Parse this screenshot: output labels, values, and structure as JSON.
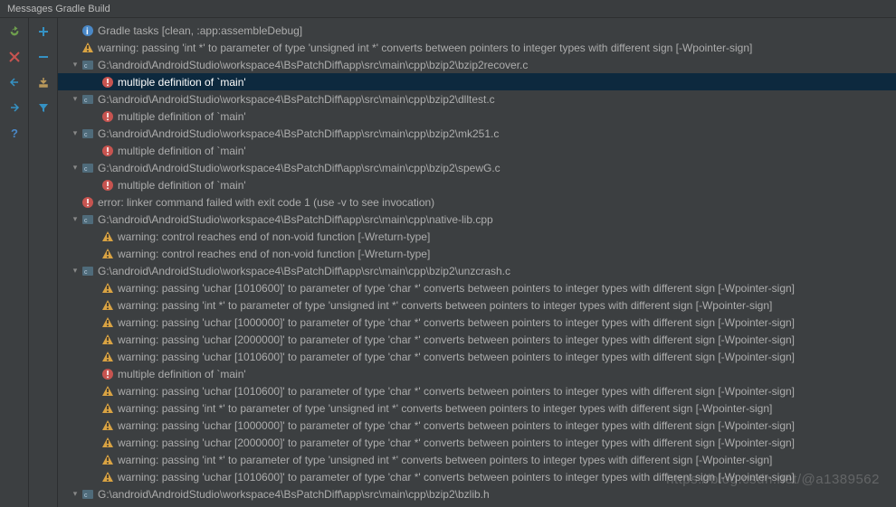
{
  "header": {
    "title": "Messages Gradle Build"
  },
  "toolbar1": {
    "refresh": "refresh",
    "stop": "stop",
    "up": "up",
    "down": "down",
    "help": "help"
  },
  "toolbar2": {
    "expand": "expand",
    "collapse": "collapse",
    "export": "export",
    "filter": "filter"
  },
  "watermark": "https://blog.csdn.net/@a1389562",
  "tree": [
    {
      "indent": 0,
      "arrow": false,
      "icon": "info",
      "text": "Gradle tasks [clean, :app:assembleDebug]"
    },
    {
      "indent": 0,
      "arrow": false,
      "icon": "warn",
      "text": "warning: passing 'int *' to parameter of type 'unsigned int *' converts between pointers to integer types with different sign [-Wpointer-sign]"
    },
    {
      "indent": 0,
      "arrow": true,
      "icon": "cpp",
      "text": "G:\\android\\AndroidStudio\\workspace4\\BsPatchDiff\\app\\src\\main\\cpp\\bzip2\\bzip2recover.c"
    },
    {
      "indent": 1,
      "arrow": false,
      "icon": "error",
      "text": "multiple definition of `main'",
      "selected": true
    },
    {
      "indent": 0,
      "arrow": true,
      "icon": "cpp",
      "text": "G:\\android\\AndroidStudio\\workspace4\\BsPatchDiff\\app\\src\\main\\cpp\\bzip2\\dlltest.c"
    },
    {
      "indent": 1,
      "arrow": false,
      "icon": "error",
      "text": "multiple definition of `main'"
    },
    {
      "indent": 0,
      "arrow": true,
      "icon": "cpp",
      "text": "G:\\android\\AndroidStudio\\workspace4\\BsPatchDiff\\app\\src\\main\\cpp\\bzip2\\mk251.c"
    },
    {
      "indent": 1,
      "arrow": false,
      "icon": "error",
      "text": "multiple definition of `main'"
    },
    {
      "indent": 0,
      "arrow": true,
      "icon": "cpp",
      "text": "G:\\android\\AndroidStudio\\workspace4\\BsPatchDiff\\app\\src\\main\\cpp\\bzip2\\spewG.c"
    },
    {
      "indent": 1,
      "arrow": false,
      "icon": "error",
      "text": "multiple definition of `main'"
    },
    {
      "indent": 0,
      "arrow": false,
      "icon": "error",
      "text": "error: linker command failed with exit code 1 (use -v to see invocation)"
    },
    {
      "indent": 0,
      "arrow": true,
      "icon": "cpp",
      "text": "G:\\android\\AndroidStudio\\workspace4\\BsPatchDiff\\app\\src\\main\\cpp\\native-lib.cpp"
    },
    {
      "indent": 1,
      "arrow": false,
      "icon": "warn",
      "text": "warning: control reaches end of non-void function [-Wreturn-type]"
    },
    {
      "indent": 1,
      "arrow": false,
      "icon": "warn",
      "text": "warning: control reaches end of non-void function [-Wreturn-type]"
    },
    {
      "indent": 0,
      "arrow": true,
      "icon": "cpp",
      "text": "G:\\android\\AndroidStudio\\workspace4\\BsPatchDiff\\app\\src\\main\\cpp\\bzip2\\unzcrash.c"
    },
    {
      "indent": 1,
      "arrow": false,
      "icon": "warn",
      "text": "warning: passing 'uchar [1010600]' to parameter of type 'char *' converts between pointers to integer types with different sign [-Wpointer-sign]"
    },
    {
      "indent": 1,
      "arrow": false,
      "icon": "warn",
      "text": "warning: passing 'int *' to parameter of type 'unsigned int *' converts between pointers to integer types with different sign [-Wpointer-sign]"
    },
    {
      "indent": 1,
      "arrow": false,
      "icon": "warn",
      "text": "warning: passing 'uchar [1000000]' to parameter of type 'char *' converts between pointers to integer types with different sign [-Wpointer-sign]"
    },
    {
      "indent": 1,
      "arrow": false,
      "icon": "warn",
      "text": "warning: passing 'uchar [2000000]' to parameter of type 'char *' converts between pointers to integer types with different sign [-Wpointer-sign]"
    },
    {
      "indent": 1,
      "arrow": false,
      "icon": "warn",
      "text": "warning: passing 'uchar [1010600]' to parameter of type 'char *' converts between pointers to integer types with different sign [-Wpointer-sign]"
    },
    {
      "indent": 1,
      "arrow": false,
      "icon": "error",
      "text": "multiple definition of `main'"
    },
    {
      "indent": 1,
      "arrow": false,
      "icon": "warn",
      "text": "warning: passing 'uchar [1010600]' to parameter of type 'char *' converts between pointers to integer types with different sign [-Wpointer-sign]"
    },
    {
      "indent": 1,
      "arrow": false,
      "icon": "warn",
      "text": "warning: passing 'int *' to parameter of type 'unsigned int *' converts between pointers to integer types with different sign [-Wpointer-sign]"
    },
    {
      "indent": 1,
      "arrow": false,
      "icon": "warn",
      "text": "warning: passing 'uchar [1000000]' to parameter of type 'char *' converts between pointers to integer types with different sign [-Wpointer-sign]"
    },
    {
      "indent": 1,
      "arrow": false,
      "icon": "warn",
      "text": "warning: passing 'uchar [2000000]' to parameter of type 'char *' converts between pointers to integer types with different sign [-Wpointer-sign]"
    },
    {
      "indent": 1,
      "arrow": false,
      "icon": "warn",
      "text": "warning: passing 'int *' to parameter of type 'unsigned int *' converts between pointers to integer types with different sign [-Wpointer-sign]"
    },
    {
      "indent": 1,
      "arrow": false,
      "icon": "warn",
      "text": "warning: passing 'uchar [1010600]' to parameter of type 'char *' converts between pointers to integer types with different sign [-Wpointer-sign]"
    },
    {
      "indent": 0,
      "arrow": true,
      "icon": "cpp",
      "text": "G:\\android\\AndroidStudio\\workspace4\\BsPatchDiff\\app\\src\\main\\cpp\\bzip2\\bzlib.h"
    }
  ]
}
